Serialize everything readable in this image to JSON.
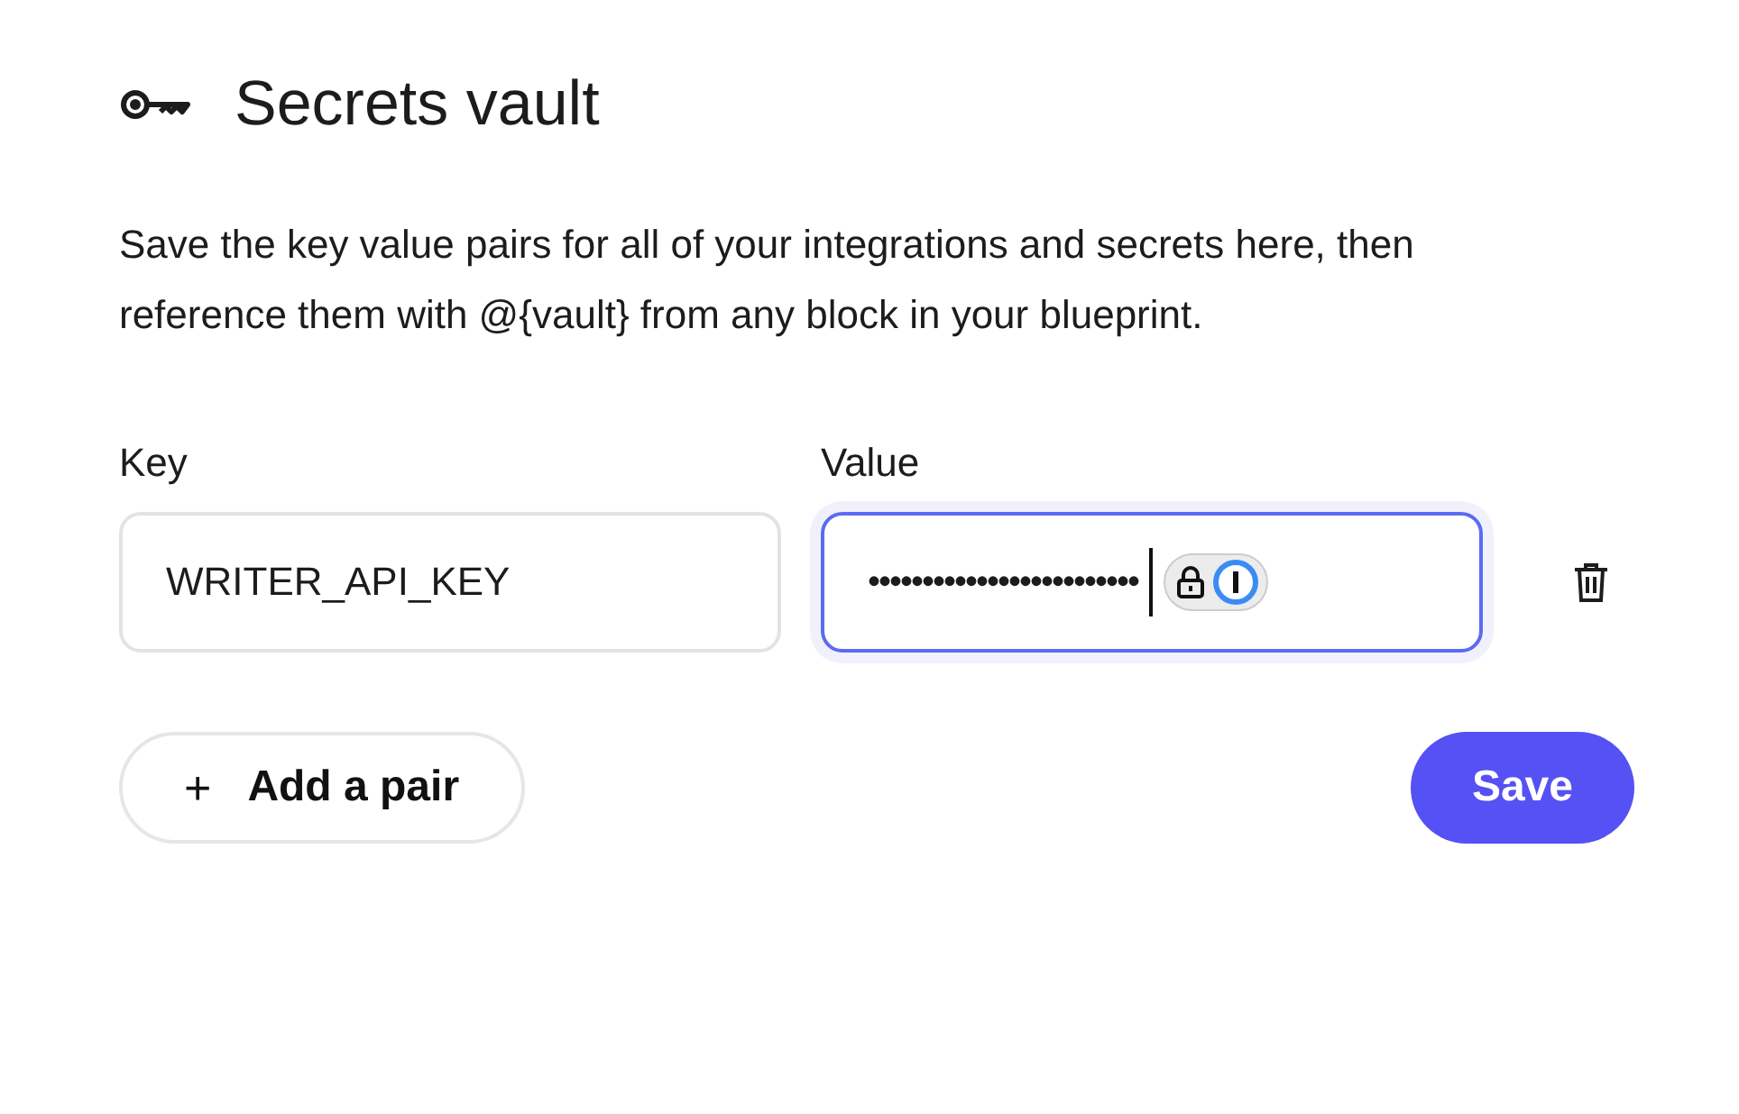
{
  "title": "Secrets vault",
  "description": "Save the key value pairs for all of your integrations and secrets here, then reference them with @{vault} from any block in your blueprint.",
  "columns": [
    "Key",
    "Value"
  ],
  "pairs": [
    {
      "key": "WRITER_API_KEY",
      "value": "•••••••••••••••••••••••••",
      "focused": true
    }
  ],
  "add_button": {
    "icon": "+",
    "label": "Add a pair"
  },
  "save_button": "Save"
}
